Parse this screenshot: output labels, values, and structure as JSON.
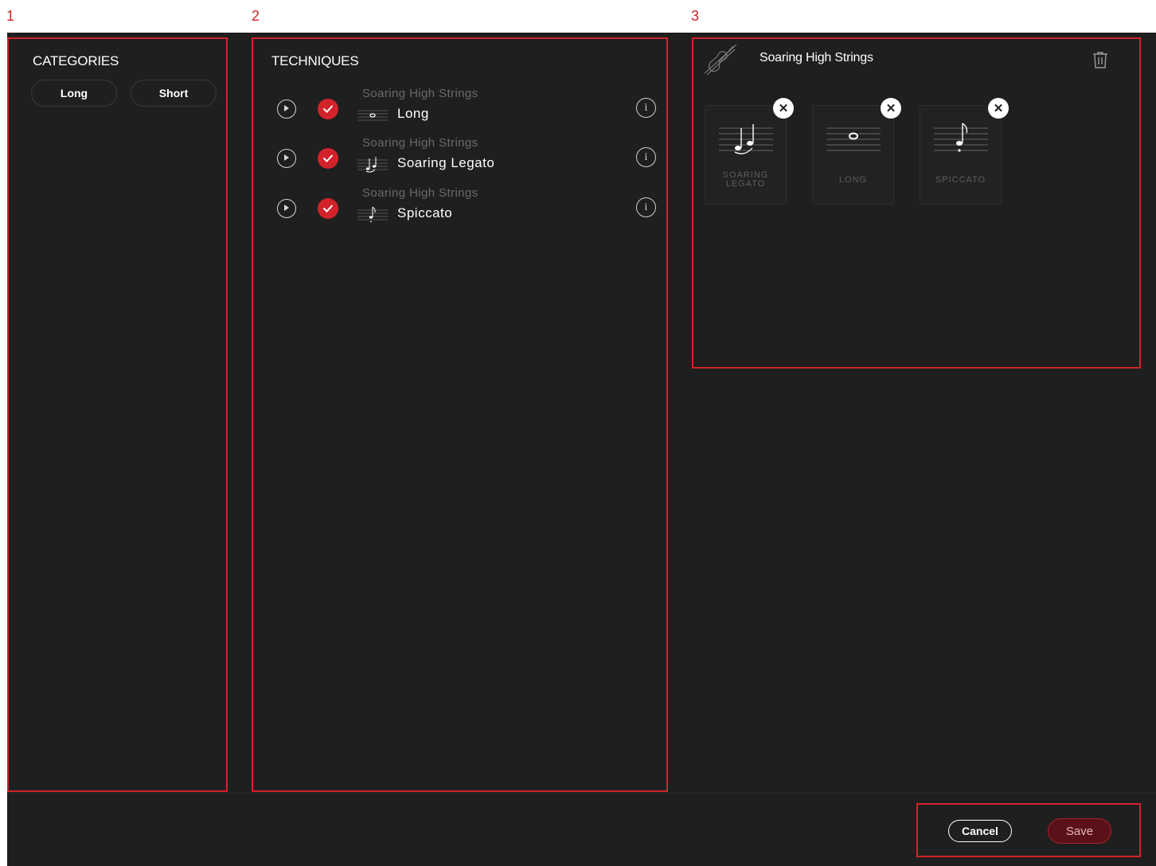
{
  "annotations": {
    "n1": "1",
    "n2": "2",
    "n3": "3"
  },
  "categories": {
    "title": "CATEGORIES",
    "items": [
      {
        "label": "Long"
      },
      {
        "label": "Short"
      }
    ]
  },
  "techniques": {
    "title": "TECHNIQUES",
    "items": [
      {
        "instrument": "Soaring High Strings",
        "label": "Long",
        "icon": "whole-note-icon"
      },
      {
        "instrument": "Soaring High Strings",
        "label": "Soaring Legato",
        "icon": "legato-notes-icon"
      },
      {
        "instrument": "Soaring High Strings",
        "label": "Spiccato",
        "icon": "spiccato-note-icon"
      }
    ],
    "info_glyph": "i"
  },
  "preset": {
    "title": "Soaring High Strings",
    "icon": "violin-icon",
    "delete_icon": "trash-icon",
    "cards": [
      {
        "label": "SOARING LEGATO",
        "icon": "legato-notes-icon"
      },
      {
        "label": "LONG",
        "icon": "whole-note-icon"
      },
      {
        "label": "SPICCATO",
        "icon": "spiccato-note-icon"
      }
    ],
    "remove_glyph": "✕"
  },
  "footer": {
    "cancel_label": "Cancel",
    "save_label": "Save"
  },
  "colors": {
    "accent": "#d2232a",
    "background": "#1f1f1f",
    "text": "#ffffff"
  }
}
